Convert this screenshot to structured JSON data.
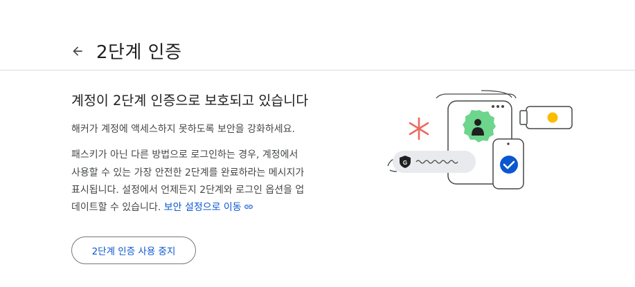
{
  "header": {
    "back_icon": "arrow-back-icon",
    "title": "2단계 인증"
  },
  "main": {
    "heading": "계정이 2단계 인증으로 보호되고 있습니다",
    "intro": "해커가 계정에 액세스하지 못하도록 보안을 강화하세요.",
    "body_lines": [
      "패스키가 아닌 다른 방법으로 로그인하는 경우, 계정에서",
      "사용할 수 있는 가장 안전한 2단계를 완료하라는 메시지가",
      "표시됩니다. 설정에서 언제든지 2단계와 로그인 옵션을 업",
      "데이트할 수 있습니다."
    ],
    "link_text": "보안 설정으로 이동",
    "link_icon": "link-icon",
    "turn_off_label": "2단계 인증 사용 중지"
  },
  "illustration": {
    "badge_letter": "G",
    "colors": {
      "green_badge": "#6dd58c",
      "blue_check": "#0b57d0",
      "red_asterisk": "#ee675c",
      "yellow_dot": "#fbbc04",
      "pill": "#e8eaed"
    }
  }
}
